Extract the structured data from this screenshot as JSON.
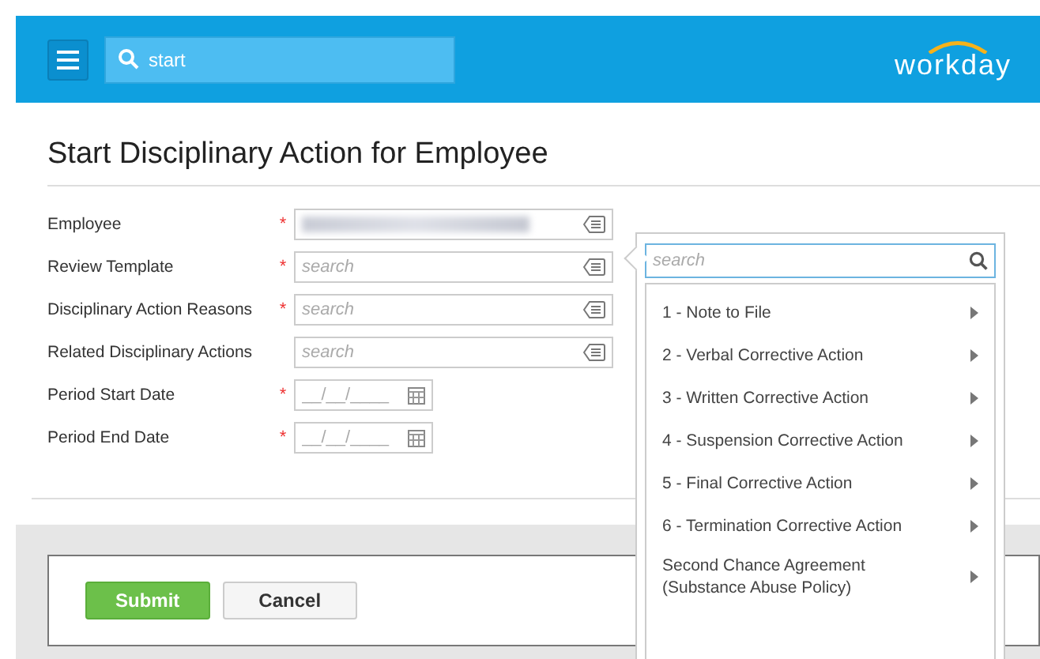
{
  "header": {
    "search": {
      "value": "start"
    },
    "logo": "workday"
  },
  "page": {
    "title": "Start Disciplinary Action for Employee"
  },
  "fields": [
    {
      "label": "Employee",
      "required_mark": "*",
      "kind": "redacted"
    },
    {
      "label": "Review Template",
      "required_mark": "*",
      "kind": "prompt",
      "placeholder": "search"
    },
    {
      "label": "Disciplinary Action Reasons",
      "required_mark": "*",
      "kind": "prompt",
      "placeholder": "search"
    },
    {
      "label": "Related Disciplinary Actions",
      "kind": "prompt",
      "placeholder": "search"
    },
    {
      "label": "Period Start Date",
      "required_mark": "*",
      "kind": "date",
      "placeholder": "__/__/____"
    },
    {
      "label": "Period End Date",
      "required_mark": "*",
      "kind": "date",
      "placeholder": "__/__/____"
    }
  ],
  "dropdown": {
    "search": {
      "placeholder": "search"
    },
    "items": [
      {
        "label": "1 - Note to File"
      },
      {
        "label": "2 - Verbal Corrective Action"
      },
      {
        "label": "3 - Written Corrective Action"
      },
      {
        "label": "4 - Suspension Corrective Action"
      },
      {
        "label": "5 - Final Corrective Action"
      },
      {
        "label": "6 - Termination Corrective Action"
      },
      {
        "label": "Second Chance Agreement (Substance Abuse Policy)"
      }
    ]
  },
  "buttons": [
    {
      "label": "Submit",
      "kind": "primary"
    },
    {
      "label": "Cancel",
      "kind": "secondary"
    }
  ]
}
